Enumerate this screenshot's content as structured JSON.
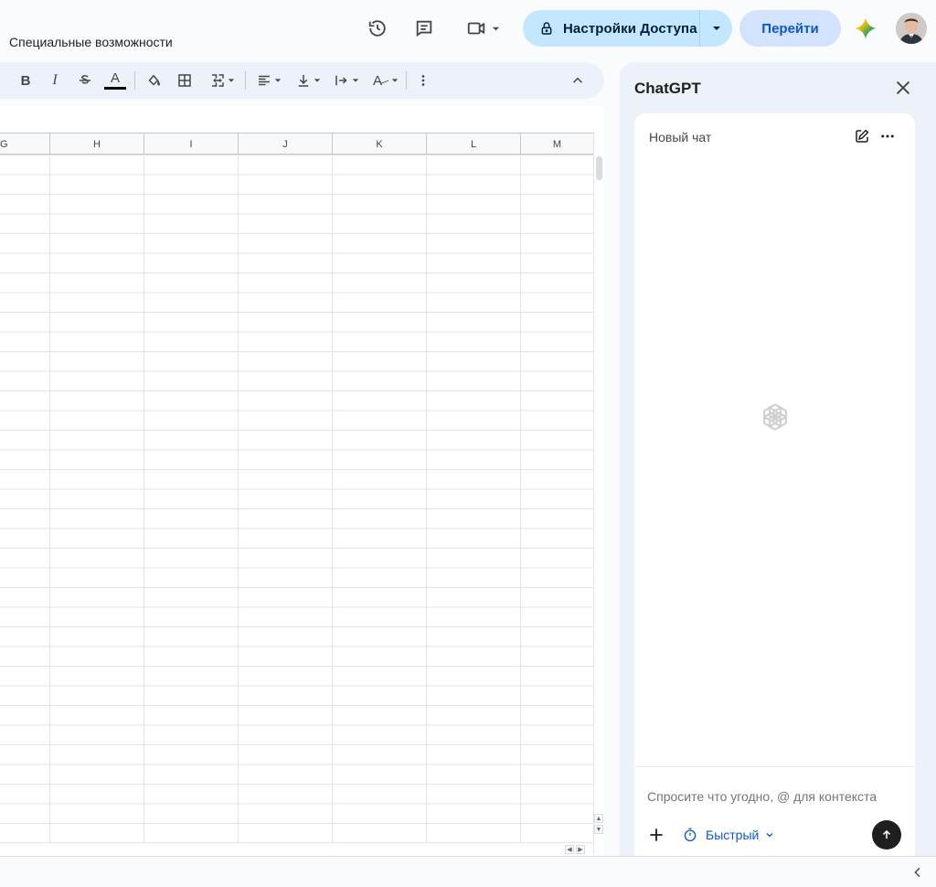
{
  "header": {
    "menu_item": "Специальные возможности",
    "share_label": "Настройки Доступа",
    "go_label": "Перейти"
  },
  "icons": {
    "history": "history-icon",
    "comments": "comment-icon",
    "meet": "video-camera-icon",
    "share_lock": "lock-icon",
    "gemini": "gemini-spark-icon",
    "avatar": "user-avatar"
  },
  "toolbar": {
    "bold_label": "B",
    "italic_label": "I",
    "text_color_label": "A",
    "text_rotate_label": "A",
    "items": [
      "bold-icon",
      "italic-icon",
      "strikethrough-icon",
      "text-color-icon",
      "fill-color-icon",
      "borders-icon",
      "merge-cells-icon",
      "horizontal-align-icon",
      "vertical-align-icon",
      "text-wrap-icon",
      "text-rotation-icon",
      "more-vert-icon",
      "collapse-up-icon"
    ]
  },
  "sheet": {
    "columns": [
      "G",
      "H",
      "I",
      "J",
      "K",
      "L",
      "M"
    ]
  },
  "side_panel": {
    "title": "ChatGPT",
    "chat_title": "Новый чат",
    "prompt_placeholder": "Спросите что угодно, @ для контекста",
    "mode_label": "Быстрый"
  },
  "colors": {
    "share_bg": "#c2e7ff",
    "go_bg": "#d3e3fd",
    "accent": "#0b57d0",
    "toolbar_bg": "#edf2fa",
    "send_bg": "#1f1f1f"
  }
}
